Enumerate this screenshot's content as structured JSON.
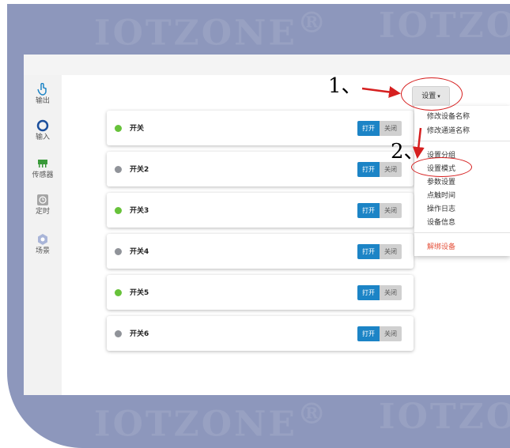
{
  "watermark": {
    "text": "IOTZONE",
    "reg": "®"
  },
  "sidebar": {
    "items": [
      {
        "label": "输出",
        "icon": "pointer-hand-icon"
      },
      {
        "label": "输入",
        "icon": "circle-input-icon"
      },
      {
        "label": "传感器",
        "icon": "sensor-chip-icon"
      },
      {
        "label": "定时",
        "icon": "timer-icon"
      },
      {
        "label": "场景",
        "icon": "scene-hexagon-icon"
      }
    ]
  },
  "settings_button": {
    "label": "设置",
    "caret": "▾"
  },
  "dropdown": {
    "items": [
      "修改设备名称",
      "修改通道名称",
      "设置分组",
      "设置模式",
      "参数设置",
      "点触时间",
      "操作日志",
      "设备信息",
      "解绑设备"
    ]
  },
  "switches": [
    {
      "label": "开关",
      "status": "on",
      "open_label": "打开",
      "close_label": "关闭"
    },
    {
      "label": "开关2",
      "status": "off",
      "open_label": "打开",
      "close_label": "关闭"
    },
    {
      "label": "开关3",
      "status": "on",
      "open_label": "打开",
      "close_label": "关闭"
    },
    {
      "label": "开关4",
      "status": "off",
      "open_label": "打开",
      "close_label": "关闭"
    },
    {
      "label": "开关5",
      "status": "on",
      "open_label": "打开",
      "close_label": "关闭"
    },
    {
      "label": "开关6",
      "status": "off",
      "open_label": "打开",
      "close_label": "关闭"
    }
  ],
  "annotations": {
    "step1": "1、",
    "step2": "2、"
  },
  "colors": {
    "background": "#8d97bc",
    "primary": "#1c84c6",
    "status_on": "#67c23a",
    "status_off": "#909399",
    "annotation": "#d62020",
    "danger": "#e5533d"
  }
}
